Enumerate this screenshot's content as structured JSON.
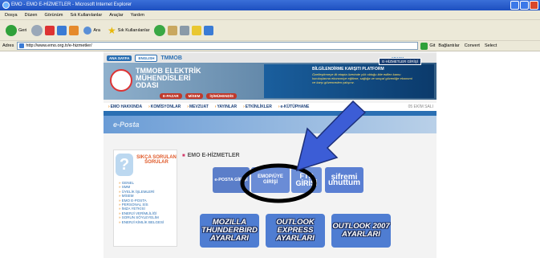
{
  "window": {
    "title": "EMO - EMO E-HİZMETLER - Microsoft Internet Explorer"
  },
  "menu": [
    "Dosya",
    "Düzen",
    "Görünüm",
    "Sık Kullanılanlar",
    "Araçlar",
    "Yardım"
  ],
  "toolbar": {
    "back_label": "Geri",
    "search_label": "Ara",
    "favorites_label": "Sık Kullanılanlar"
  },
  "address": {
    "label": "Adres",
    "url": "http://www.emo.org.tr/e-hizmetler/",
    "go_label": "Git",
    "links_label": "Bağlantılar",
    "convert_label": "Convert",
    "select_label": "Select"
  },
  "site": {
    "top_links": [
      "ANA SAYFA",
      "ENGLISH",
      "TMMOB"
    ],
    "search_label": "ARAMA",
    "logo_text": "TMMOB ELEKTRİK MÜHENDİSLERİ ODASI",
    "promo_button": "E-HİZMETLER GİRİŞİ",
    "promo_title": "BİLGİLENDİRME KARŞITI PLATFORM",
    "promo_text": "Özelleştirmeye ilk etapta üzerinde yük olduğu ilde edilen kamu kuruluşlarına ekonomiye eğitime, sağlığa ve sosyal güvenliğe ekonomi ve karşı güvenceden çalışırız.",
    "sub_tabs": [
      "E-PAZAR",
      "MİSEM",
      "İŞ/MÜHENDİS"
    ],
    "nav": [
      "EMO HAKKINDA",
      "KOMİSYONLAR",
      "MEVZUAT",
      "YAYINLAR",
      "ETKİNLİKLER",
      "e-KÜTÜPHANE"
    ],
    "date": "05 EKİM SALI",
    "section_title": "e-Posta",
    "faq_title": "SIKÇA SORULAN SORULAR",
    "faq_items": [
      "GENEL",
      "SMM",
      "ÜYELİK İŞLEMLERİ",
      "MİSEM",
      "EMO E-POSTA",
      "PERSONAL SİS",
      "İMZA YETKİSİ",
      "ENERJİ VERİMLİLİĞİ",
      "SORUN SÖYLEYELİM",
      "ENERJİ KİMLİK BELGESİ"
    ],
    "main_title": "EMO E-HİZMETLER",
    "services": [
      "e-POSTA GİRİŞİ",
      "EMOP/ÜYE GİRİŞİ",
      "FTP GİRİŞİ",
      "şifremi unuttum"
    ],
    "guides": [
      "MOZILLA THUNDERBIRD AYARLARI",
      "OUTLOOK EXPRESS AYARLARI",
      "OUTLOOK 2007 AYARLARI"
    ]
  },
  "colors": {
    "annotation": "#3c5dd6",
    "ring": "#000000"
  }
}
